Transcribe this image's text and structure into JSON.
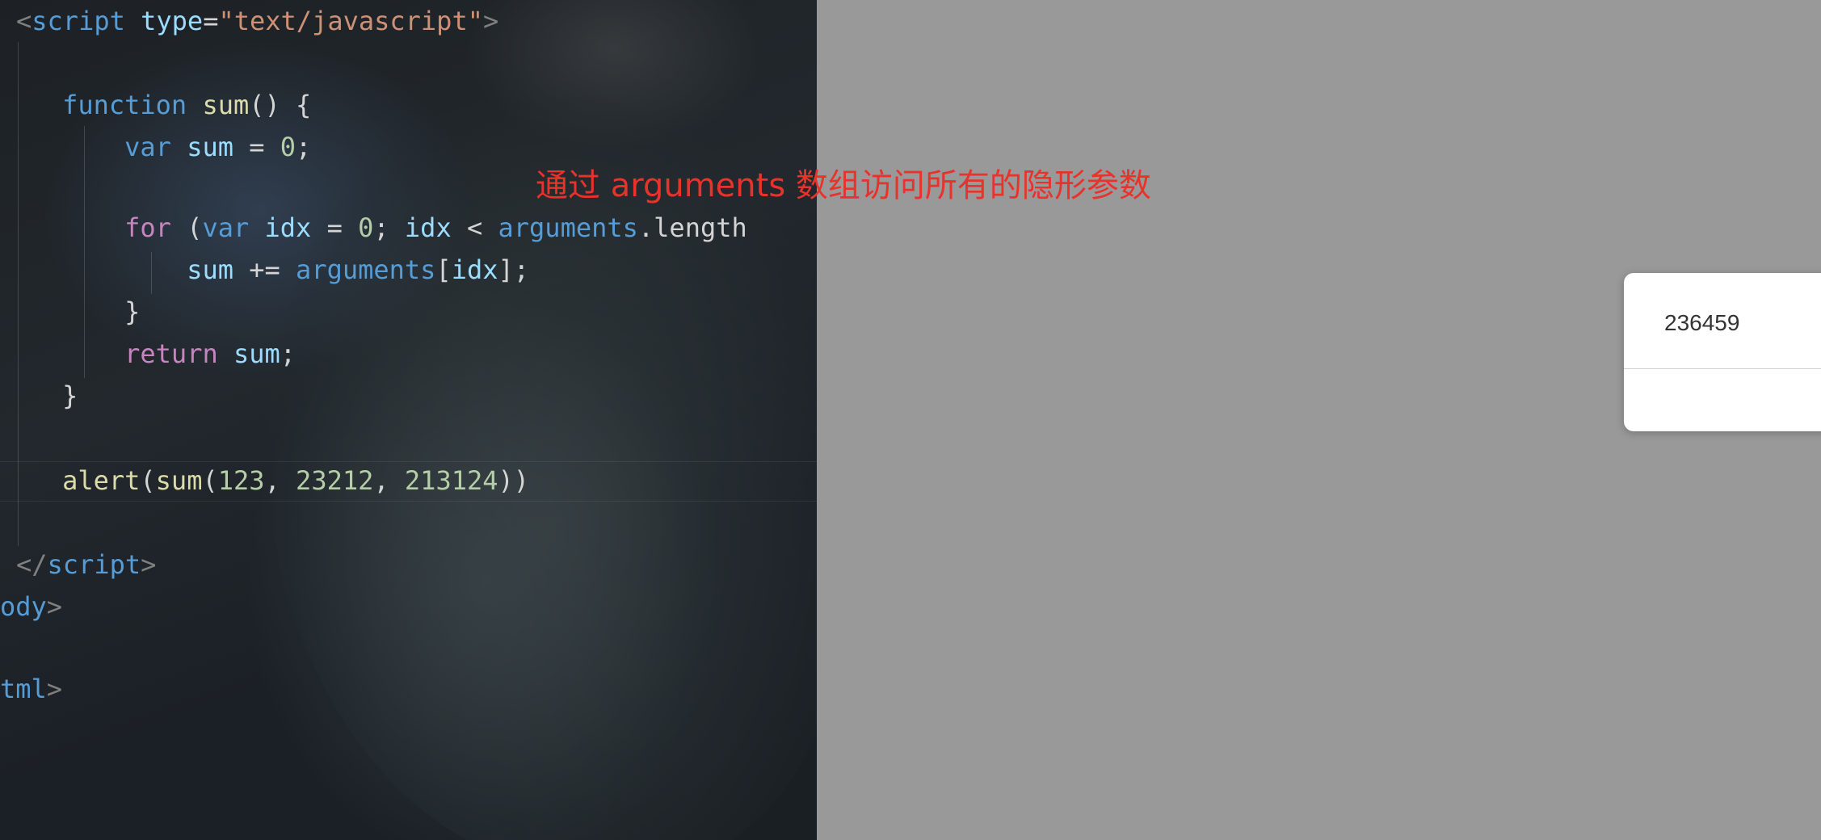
{
  "editor": {
    "lines": {
      "script_open": {
        "lt": "<",
        "tag": "script",
        "sp": " ",
        "attr": "type",
        "eq": "=",
        "str": "\"text/javascript\"",
        "gt": ">"
      },
      "function_decl": {
        "indent": "    ",
        "kw": "function",
        "sp": " ",
        "name": "sum",
        "rest": "() {"
      },
      "var_decl": {
        "indent": "        ",
        "kw": "var",
        "sp1": " ",
        "name": "sum",
        "eq": " = ",
        "num": "0",
        "semi": ";"
      },
      "for_stmt": {
        "indent": "        ",
        "kw": "for",
        "p1": " (",
        "kw2": "var",
        "sp": " ",
        "v1": "idx",
        "eq": " = ",
        "num": "0",
        "semi": "; ",
        "v2": "idx",
        "lt": " < ",
        "arg": "arguments",
        "dot": ".",
        "prop": "length"
      },
      "sum_stmt": {
        "indent": "            ",
        "v1": "sum",
        "op": " += ",
        "arg": "arguments",
        "b1": "[",
        "v2": "idx",
        "b2": "];"
      },
      "for_close": {
        "indent": "        ",
        "text": "}"
      },
      "return_stmt": {
        "indent": "        ",
        "kw": "return",
        "sp": " ",
        "v": "sum",
        "semi": ";"
      },
      "function_close": {
        "indent": "    ",
        "text": "}"
      },
      "alert_call": {
        "indent": "    ",
        "fn1": "alert",
        "p1": "(",
        "fn2": "sum",
        "p2": "(",
        "n1": "123",
        "c1": ", ",
        "n2": "23212",
        "c2": ", ",
        "n3": "213124",
        "p3": "))"
      },
      "script_close": {
        "lt": "</",
        "tag": "script",
        "gt": ">"
      },
      "body_close": {
        "tag": "ody",
        "gt": ">"
      },
      "html_close": {
        "tag": "tml",
        "gt": ">"
      }
    }
  },
  "annotation": {
    "text": "通过 arguments 数组访问所有的隐形参数",
    "color": "#e8322b"
  },
  "alert_dialog": {
    "message": "236459"
  },
  "colors": {
    "overlay": "#999999",
    "keyword": "#569cd6",
    "control_keyword": "#c586c0",
    "function": "#dcdcaa",
    "variable": "#9cdcfe",
    "number": "#b5cea8",
    "string": "#ce9178",
    "punctuation": "#808080"
  }
}
